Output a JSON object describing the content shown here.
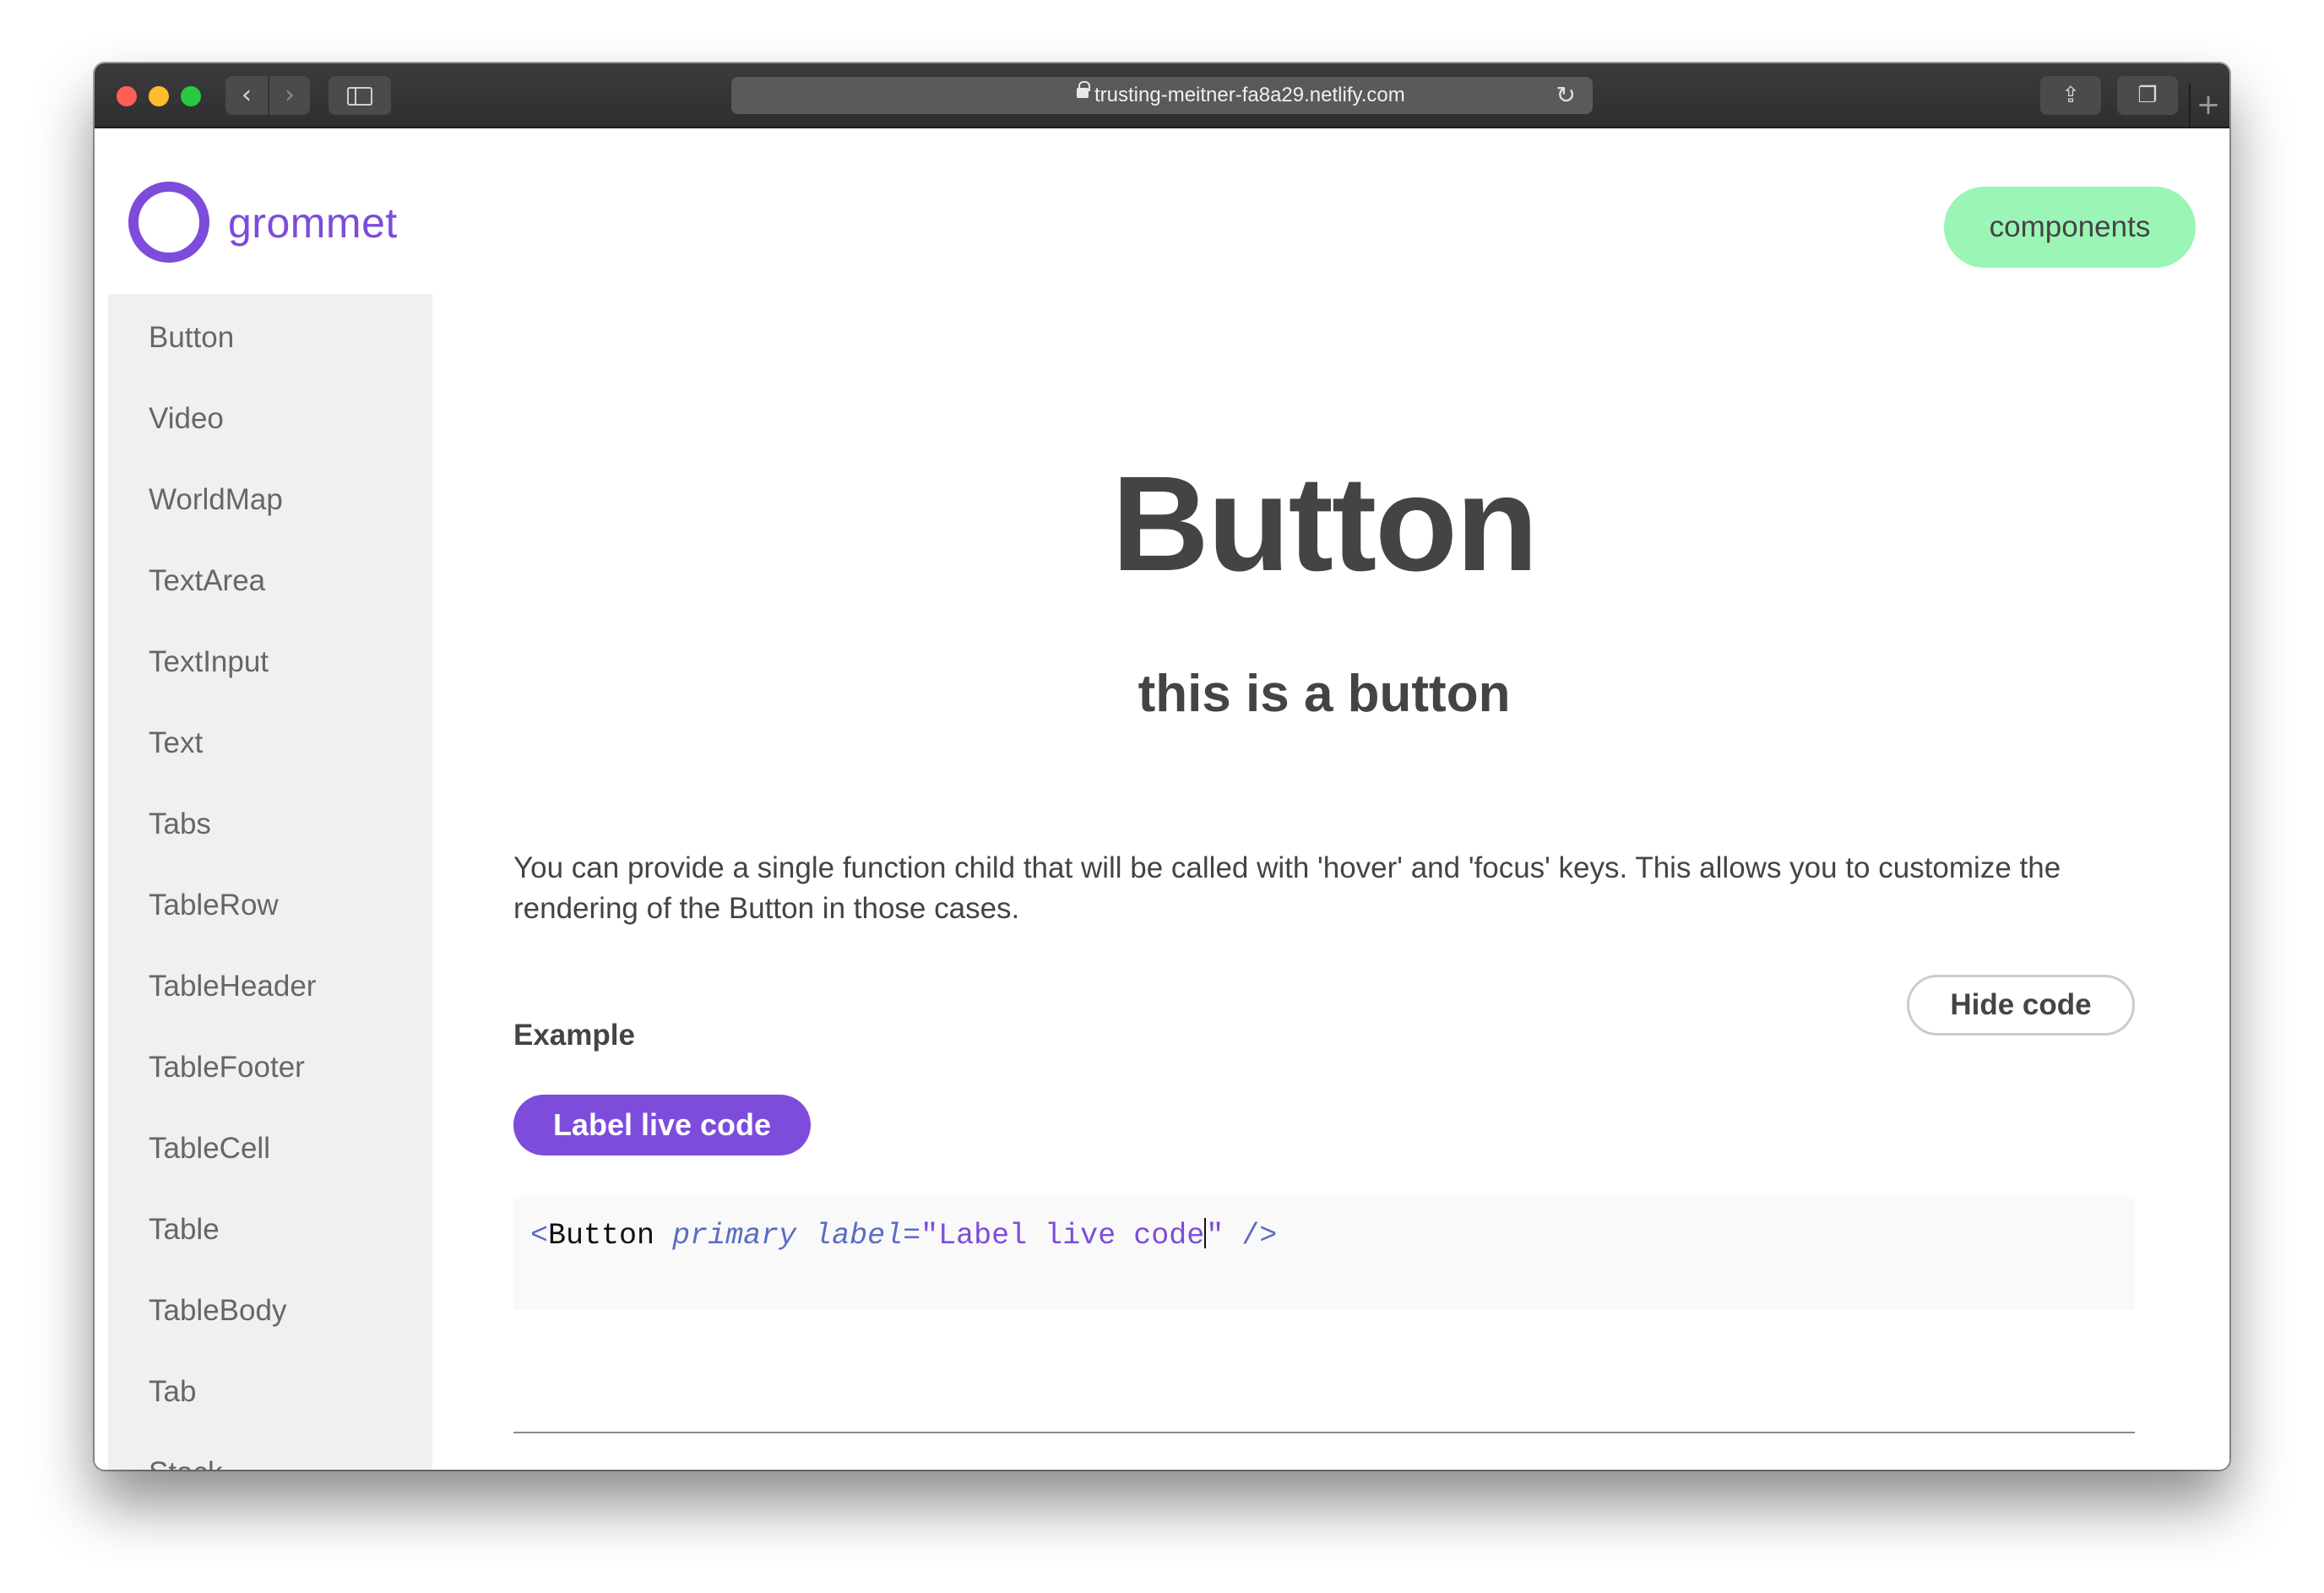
{
  "browser": {
    "url": "trusting-meitner-fa8a29.netlify.com",
    "back_icon": "chevron-left-icon",
    "forward_icon": "chevron-right-icon",
    "reload_icon": "reload-icon",
    "share_icon": "share-icon",
    "tabs_icon": "tabs-icon",
    "new_tab_icon": "plus-icon"
  },
  "header": {
    "logo_text": "grommet",
    "components_label": "components"
  },
  "sidebar": {
    "items": [
      {
        "label": "Button"
      },
      {
        "label": "Video"
      },
      {
        "label": "WorldMap"
      },
      {
        "label": "TextArea"
      },
      {
        "label": "TextInput"
      },
      {
        "label": "Text"
      },
      {
        "label": "Tabs"
      },
      {
        "label": "TableRow"
      },
      {
        "label": "TableHeader"
      },
      {
        "label": "TableFooter"
      },
      {
        "label": "TableCell"
      },
      {
        "label": "Table"
      },
      {
        "label": "TableBody"
      },
      {
        "label": "Tab"
      },
      {
        "label": "Stack"
      }
    ]
  },
  "main": {
    "title": "Button",
    "subtitle": "this is a button",
    "description": "You can provide a single function child that will be called with 'hover' and 'focus' keys. This allows you to customize the rendering of the Button in those cases.",
    "example_label": "Example",
    "hide_code_label": "Hide code",
    "live_button_label": "Label live code",
    "code": {
      "open": "<",
      "tag": "Button",
      "attr1": "primary",
      "attr2": "label",
      "eq": "=",
      "value_part": "\"Label live code",
      "value_end": "\"",
      "close": "/>"
    }
  },
  "colors": {
    "brand": "#7d4cdb",
    "accent": "#9af5b6",
    "text": "#444444",
    "sidebar_bg": "#f0f0f0"
  }
}
